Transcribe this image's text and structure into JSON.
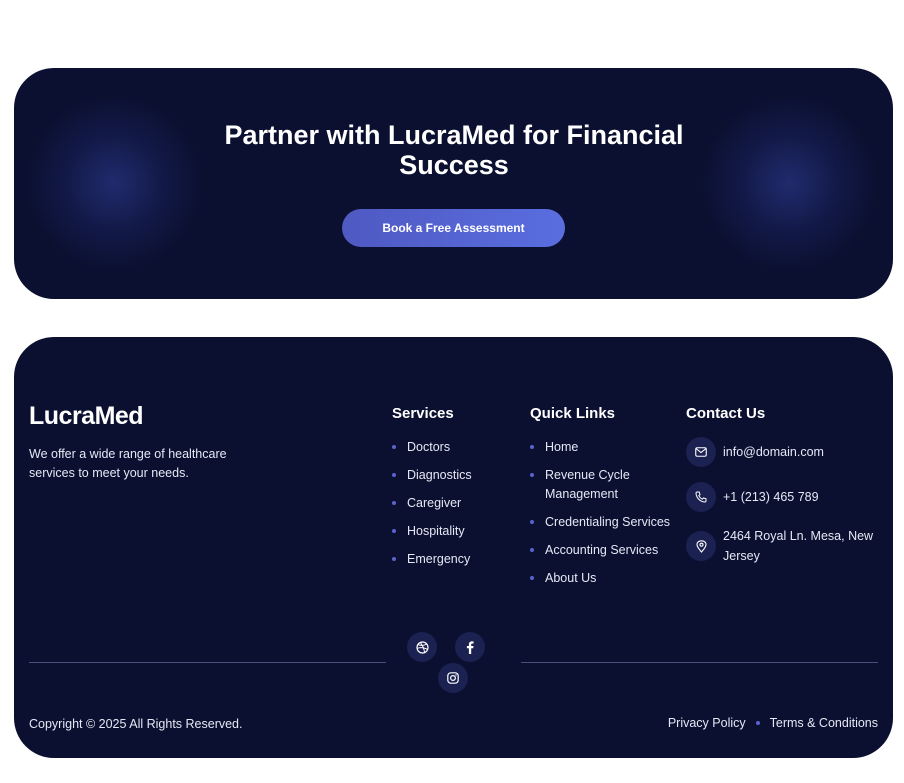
{
  "cta": {
    "heading": "Partner with LucraMed for Financial Success",
    "button_label": "Book a Free Assessment"
  },
  "footer": {
    "brand": "LucraMed",
    "tagline": "We offer a wide range of healthcare services to meet your needs.",
    "services": {
      "title": "Services",
      "items": [
        "Doctors",
        "Diagnostics",
        "Caregiver",
        "Hospitality",
        "Emergency"
      ]
    },
    "quick_links": {
      "title": "Quick Links",
      "items": [
        "Home",
        "Revenue Cycle Management",
        "Credentialing Services",
        "Accounting Services",
        "About Us"
      ]
    },
    "contact": {
      "title": "Contact Us",
      "email": "info@domain.com",
      "phone": "+1 (213) 465 789",
      "address": "2464 Royal Ln. Mesa, New Jersey"
    },
    "social_icons": [
      "dribbble-icon",
      "facebook-icon",
      "instagram-icon"
    ],
    "copyright": "Copyright © 2025 All Rights Reserved.",
    "legal_links": [
      "Privacy Policy",
      "Terms & Conditions"
    ]
  },
  "colors": {
    "background": "#0b1030",
    "accent": "#5a63c9",
    "button": "#5a6ee0"
  }
}
